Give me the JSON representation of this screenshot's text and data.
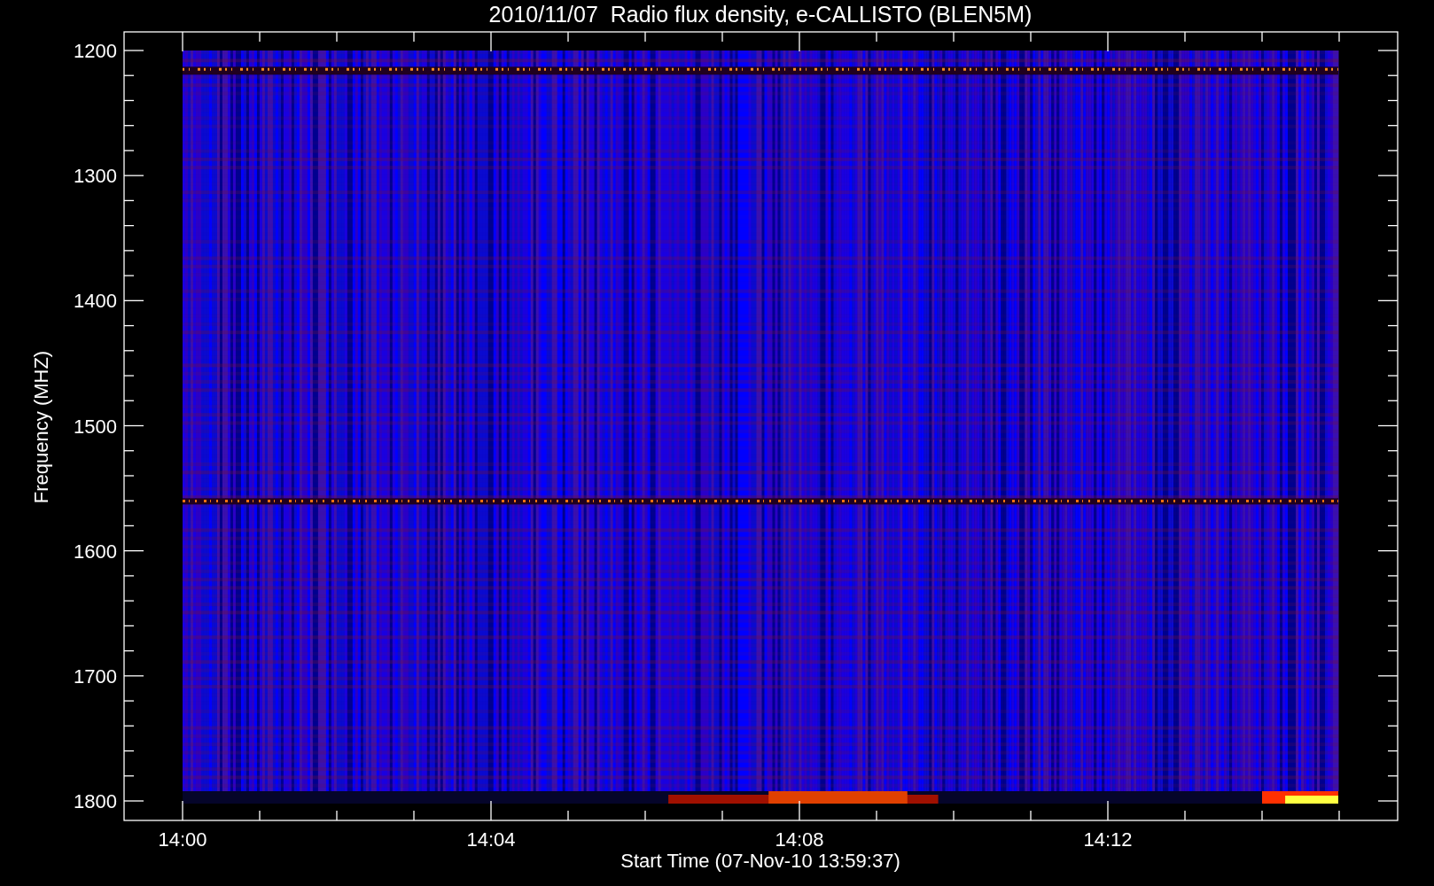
{
  "title": "2010/11/07  Radio flux density, e-CALLISTO (BLEN5M)",
  "y_axis": {
    "label": "Frequency (MHZ)",
    "ticks": [
      "1200",
      "1300",
      "1400",
      "1500",
      "1600",
      "1700",
      "1800"
    ]
  },
  "x_axis": {
    "label": "Start Time (07-Nov-10 13:59:37)",
    "ticks": [
      "14:00",
      "14:04",
      "14:08",
      "14:12"
    ]
  }
}
